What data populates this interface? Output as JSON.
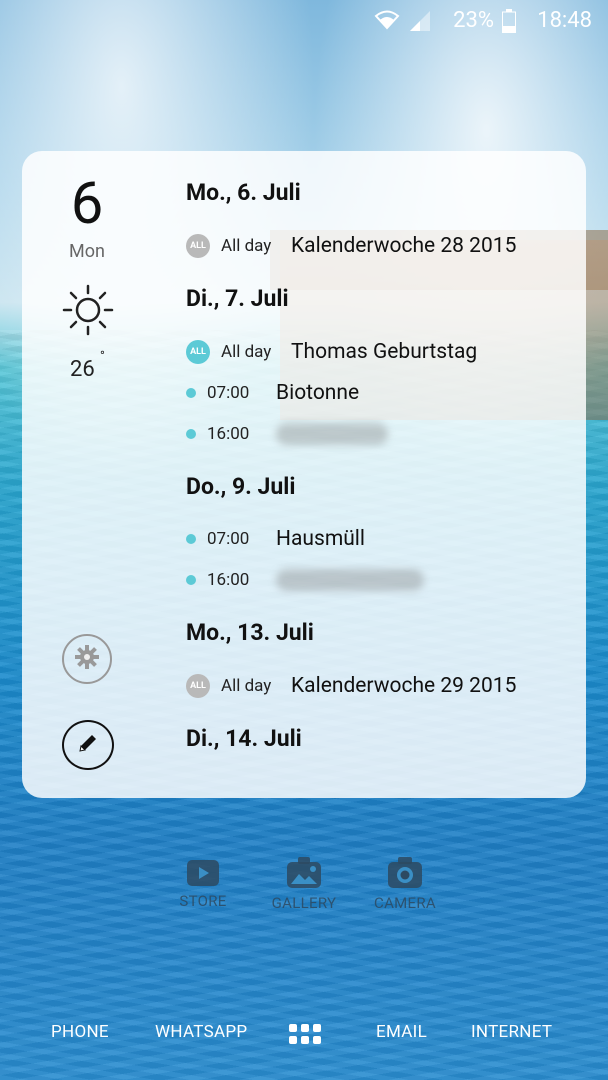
{
  "status_bar": {
    "battery_percent": "23%",
    "time": "18:48",
    "icons": [
      "wifi-icon",
      "signal-icon",
      "battery-icon"
    ]
  },
  "widget": {
    "date_number": "6",
    "date_day": "Mon",
    "weather": {
      "icon": "sun-icon",
      "temperature": "26",
      "degree_symbol": "°"
    },
    "days": [
      {
        "heading": "Mo., 6. Juli",
        "events": [
          {
            "type": "allday",
            "badge": "ALL",
            "label": "All day",
            "title": "Kalenderwoche 28 2015",
            "badge_color": "#b9b9b9"
          }
        ]
      },
      {
        "heading": "Di., 7. Juli",
        "events": [
          {
            "type": "allday",
            "badge": "ALL",
            "label": "All day",
            "title": "Thomas Geburtstag",
            "badge_color": "#5ccad6"
          },
          {
            "type": "timed",
            "time": "07:00",
            "title": "Biotonne"
          },
          {
            "type": "timed",
            "time": "16:00",
            "title": ""
          }
        ]
      },
      {
        "heading": "Do., 9. Juli",
        "events": [
          {
            "type": "timed",
            "time": "07:00",
            "title": "Hausmüll"
          },
          {
            "type": "timed",
            "time": "16:00",
            "title": ""
          }
        ]
      },
      {
        "heading": "Mo., 13. Juli",
        "events": [
          {
            "type": "allday",
            "badge": "ALL",
            "label": "All day",
            "title": "Kalenderwoche 29 2015",
            "badge_color": "#b9b9b9"
          }
        ]
      },
      {
        "heading": "Di., 14. Juli",
        "events": []
      }
    ]
  },
  "apps": [
    {
      "label": "STORE",
      "icon": "play-store-icon"
    },
    {
      "label": "GALLERY",
      "icon": "gallery-icon"
    },
    {
      "label": "CAMERA",
      "icon": "camera-icon"
    }
  ],
  "dock": {
    "phone": "PHONE",
    "whatsapp": "WHATSAPP",
    "apps_icon": "apps-grid-icon",
    "email": "EMAIL",
    "internet": "INTERNET"
  },
  "colors": {
    "accent": "#5ccad6",
    "badge_grey": "#b9b9b9"
  }
}
